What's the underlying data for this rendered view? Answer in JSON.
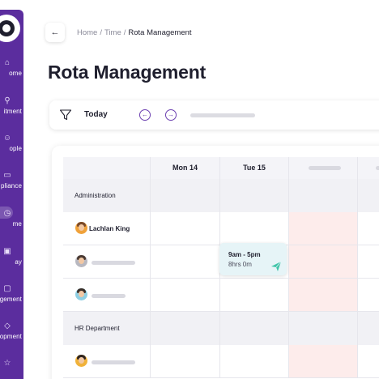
{
  "sidebar": {
    "items": [
      {
        "label": "ome",
        "icon": "home-icon"
      },
      {
        "label": "itment",
        "icon": "search-icon"
      },
      {
        "label": "ople",
        "icon": "people-icon"
      },
      {
        "label": "pliance",
        "icon": "folder-icon"
      },
      {
        "label": "me",
        "icon": "clock-icon",
        "active": true
      },
      {
        "label": "ay",
        "icon": "wallet-icon"
      },
      {
        "label": "gement",
        "icon": "chat-icon"
      },
      {
        "label": "opment",
        "icon": "graduation-icon"
      },
      {
        "label": "",
        "icon": "star-icon"
      }
    ]
  },
  "breadcrumb": {
    "home": "Home",
    "section": "Time",
    "current": "Rota Management",
    "separator": "/"
  },
  "page": {
    "title": "Rota Management"
  },
  "filter": {
    "today": "Today"
  },
  "rota": {
    "columns": [
      "Mon 14",
      "Tue 15"
    ],
    "groups": {
      "admin": "Administration",
      "hr": "HR Department"
    },
    "employees": {
      "lachlan": "Lachlan King"
    },
    "shift": {
      "time": "9am - 5pm",
      "hours": "8hrs 0m"
    }
  },
  "colors": {
    "sidebar": "#5b2d9e",
    "accent": "#6b3fb0",
    "highlight_column": "#fdeceb",
    "shift_chip": "#e6f4f7",
    "send_icon": "#3fc4a8"
  }
}
